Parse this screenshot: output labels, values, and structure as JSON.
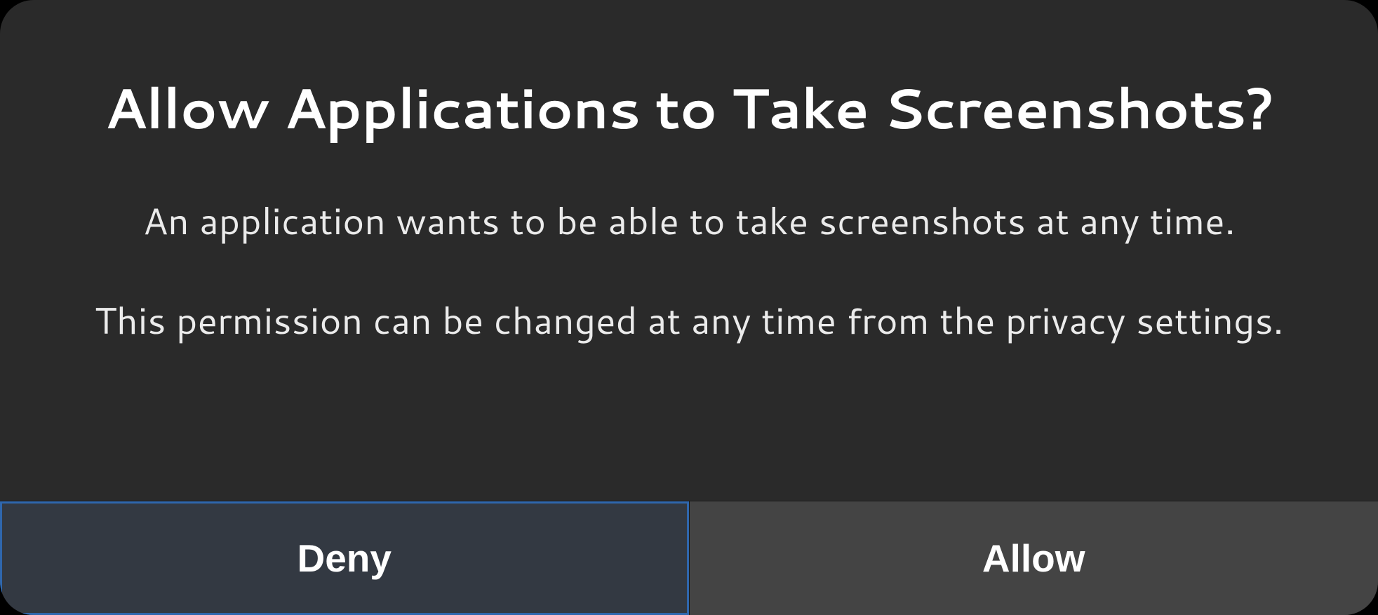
{
  "dialog": {
    "title": "Allow Applications to Take Screenshots?",
    "body_line_1": "An application wants to be able to take screenshots at any time.",
    "body_line_2": "This permission can be changed at any time from the privacy settings.",
    "buttons": {
      "deny": "Deny",
      "allow": "Allow"
    }
  }
}
